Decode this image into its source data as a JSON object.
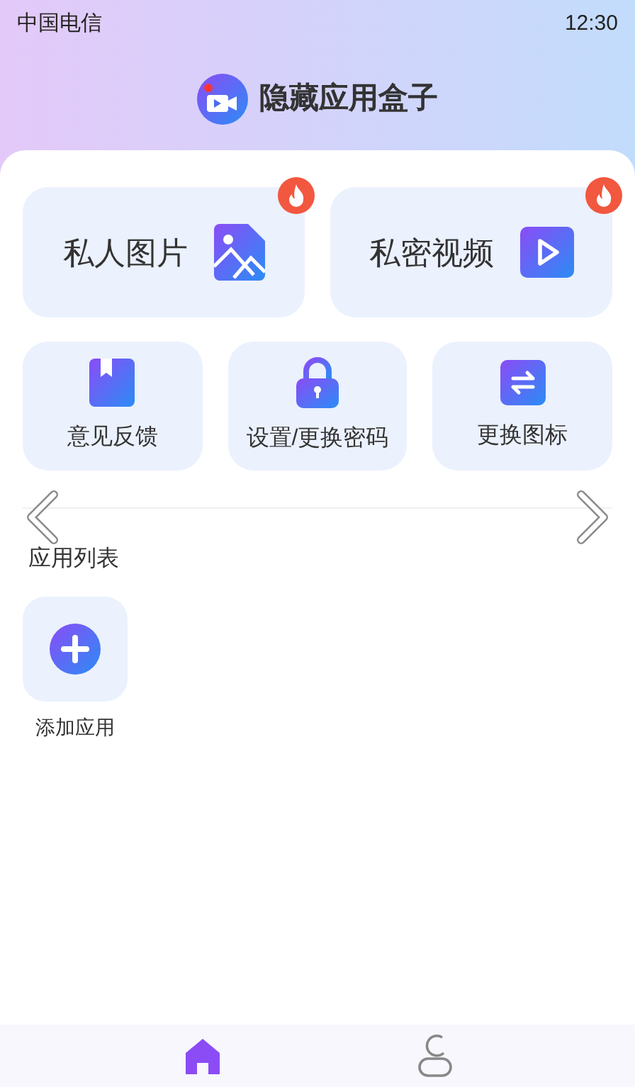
{
  "status_bar": {
    "carrier": "中国电信",
    "time": "12:30"
  },
  "header": {
    "title": "隐藏应用盒子"
  },
  "feature_cards": [
    {
      "label": "私人图片",
      "kind": "image",
      "hot": true
    },
    {
      "label": "私密视频",
      "kind": "video",
      "hot": true
    }
  ],
  "tools": [
    {
      "label": "意见反馈",
      "kind": "bookmark"
    },
    {
      "label": "设置/更换密码",
      "kind": "lock"
    },
    {
      "label": "更换图标",
      "kind": "swap"
    }
  ],
  "app_list": {
    "title": "应用列表",
    "items": [
      {
        "label": "添加应用",
        "kind": "add"
      }
    ]
  },
  "bottom_nav": [
    {
      "kind": "home",
      "selected": true
    },
    {
      "kind": "profile",
      "selected": false
    }
  ]
}
